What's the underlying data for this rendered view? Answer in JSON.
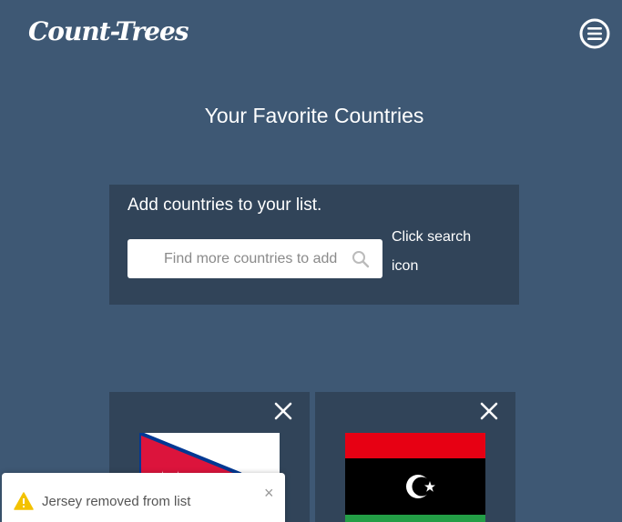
{
  "header": {
    "logo": "Count-Trees",
    "menu_icon": "hamburger-menu-icon"
  },
  "main": {
    "title": "Your Favorite Countries",
    "search_panel": {
      "heading": "Add countries to your list.",
      "search_placeholder": "Find more countries to add",
      "search_value": "",
      "search_icon": "search-icon",
      "hint": "Click search icon"
    },
    "countries": [
      {
        "flag": "nepal-flag",
        "remove_icon": "close-icon"
      },
      {
        "flag": "libya-flag",
        "remove_icon": "close-icon"
      }
    ]
  },
  "toast": {
    "icon": "warning-icon",
    "message": "Jersey removed from list",
    "close": "×",
    "colors": {
      "warning": "#f3c200"
    }
  },
  "colors": {
    "background": "#3e5874",
    "panel": "#314459"
  }
}
